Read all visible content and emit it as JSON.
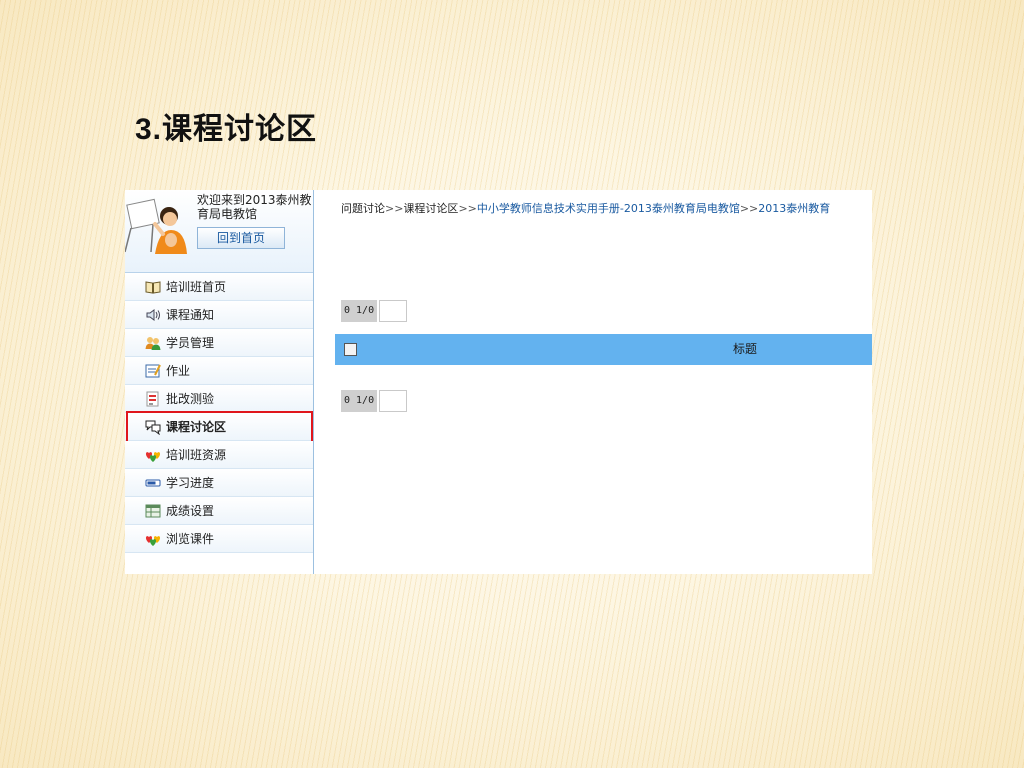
{
  "slide": {
    "number": "3.",
    "title": "课程讨论区"
  },
  "sidebar": {
    "welcome": "欢迎来到2013泰州教育局电教馆",
    "home_button": "回到首页",
    "items": [
      {
        "label": "培训班首页",
        "icon": "book-icon"
      },
      {
        "label": "课程通知",
        "icon": "speaker-icon"
      },
      {
        "label": "学员管理",
        "icon": "users-icon"
      },
      {
        "label": "作业",
        "icon": "homework-icon"
      },
      {
        "label": "批改测验",
        "icon": "grading-icon"
      },
      {
        "label": "课程讨论区",
        "icon": "chat-bubbles-icon",
        "active": true
      },
      {
        "label": "培训班资源",
        "icon": "hearts-icon"
      },
      {
        "label": "学习进度",
        "icon": "progress-icon"
      },
      {
        "label": "成绩设置",
        "icon": "grade-table-icon"
      },
      {
        "label": "浏览课件",
        "icon": "hearts-icon"
      }
    ]
  },
  "main": {
    "breadcrumb": {
      "part1": "问题讨论",
      "sep": ">>",
      "part2": "课程讨论区",
      "part3": "中小学教师信息技术实用手册-2013泰州教育局电教馆",
      "part4": "2013泰州教育"
    },
    "pager_top": {
      "label": "0 1/0"
    },
    "pager_bottom": {
      "label": "0 1/0"
    },
    "table": {
      "column_title": "标题"
    }
  },
  "colors": {
    "highlight_border": "#e0161c",
    "table_header": "#63b2ef",
    "link": "#1a5aa0"
  }
}
